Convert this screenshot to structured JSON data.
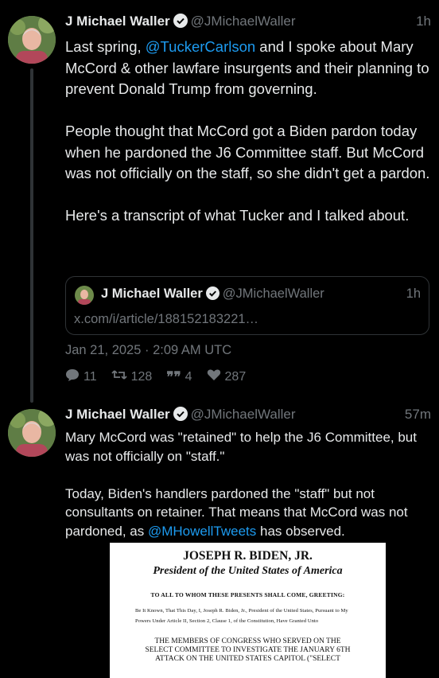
{
  "tweet1": {
    "name": "J Michael Waller",
    "handle": "@JMichaelWaller",
    "time": "1h",
    "text_pre": "Last spring, ",
    "mention": "@TuckerCarlson",
    "text_post": " and I spoke about Mary McCord & other lawfare insurgents and their planning to prevent Donald Trump from governing.\n\nPeople thought that McCord got a Biden pardon today when he pardoned the J6 Committee staff. But McCord was not officially on the staff, so she didn't get a pardon.\n\nHere's a transcript of what Tucker and I talked about.",
    "quote": {
      "name": "J Michael Waller",
      "handle": "@JMichaelWaller",
      "time": "1h",
      "link": "x.com/i/article/188152183221…"
    },
    "timestamp": "Jan 21, 2025 · 2:09 AM UTC",
    "stats": {
      "replies": "11",
      "retweets": "128",
      "quotes": "4",
      "likes": "287"
    }
  },
  "tweet2": {
    "name": "J Michael Waller",
    "handle": "@JMichaelWaller",
    "time": "57m",
    "text_a": "Mary McCord was \"retained\" to help the J6 Committee, but was not officially on \"staff.\"\n\nToday, Biden's handlers pardoned the \"staff\" but not consultants on retainer. That means that McCord was not pardoned, as ",
    "mention": "@MHowellTweets",
    "text_b": " has observed."
  },
  "document": {
    "title": "JOSEPH R. BIDEN, JR.",
    "subtitle": "President of the United States of America",
    "greeting": "TO ALL TO WHOM THESE PRESENTS SHALL COME, GREETING:",
    "text": "Be It Known, That This Day, I, Joseph R. Biden, Jr., President of the United States, Pursuant to My Powers Under Article II, Section 2, Clause 1, of the Constitution, Have Granted Unto",
    "caps": "THE MEMBERS OF CONGRESS WHO SERVED ON THE SELECT COMMITTEE TO INVESTIGATE THE JANUARY 6TH ATTACK ON THE UNITED STATES CAPITOL (\"SELECT"
  },
  "colors": {
    "background": "#000000",
    "text": "#e7e9ea",
    "muted": "#71767b",
    "link": "#1d9bf0",
    "border": "#2f3336"
  }
}
